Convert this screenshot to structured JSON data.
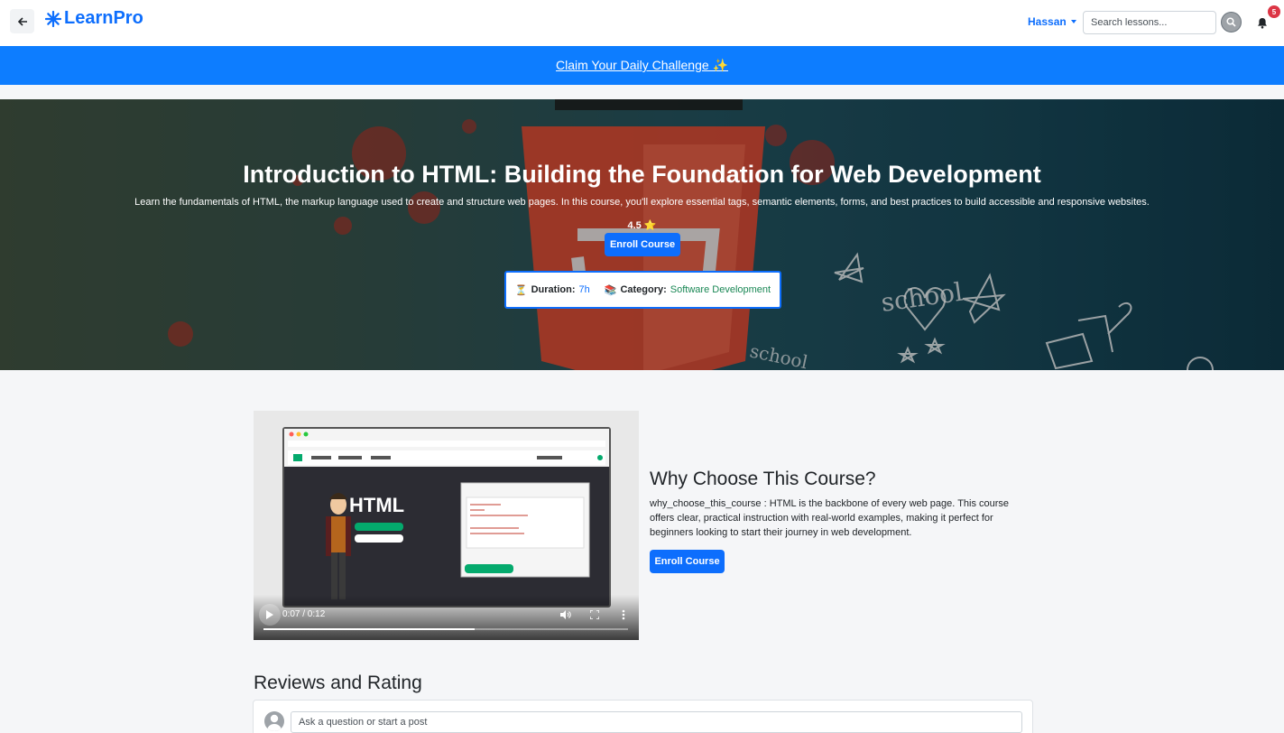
{
  "navbar": {
    "brand": "LearnPro",
    "user_name": "Hassan",
    "search_placeholder": "Search lessons...",
    "notification_count": "5",
    "icons": [
      "back-arrow-icon",
      "logo-asterisk-icon",
      "search-icon",
      "bell-icon"
    ]
  },
  "banner": {
    "text": "Claim Your Daily Challenge ✨"
  },
  "course": {
    "title": "Introduction to HTML: Building the Foundation for Web Development",
    "description": "Learn the fundamentals of HTML, the markup language used to create and structure web pages. In this course, you'll explore essential tags, semantic elements, forms, and best practices to build accessible and responsive websites.",
    "rating": "4.5",
    "rating_icon": "⭐",
    "enroll_label": "Enroll Course",
    "duration_label": "Duration:",
    "duration_value": "7h",
    "duration_icon": "⏳",
    "category_label": "Category:",
    "category_value": "Software Development",
    "category_icon": "📚"
  },
  "video": {
    "time": "0:07 / 0:12",
    "progress": 0.58
  },
  "why": {
    "title": "Why Choose This Course?",
    "text": "why_choose_this_course : HTML is the backbone of every web page. This course offers clear, practical instruction with real-world examples, making it perfect for beginners looking to start their journey in web development.",
    "enroll_label": "Enroll Course"
  },
  "reviews": {
    "title": "Reviews and Rating",
    "input_placeholder": "Ask a question or start a post"
  },
  "colors": {
    "primary": "#0d6efd",
    "banner": "#0d7dff",
    "category": "#198754",
    "badge": "#dc3545"
  }
}
